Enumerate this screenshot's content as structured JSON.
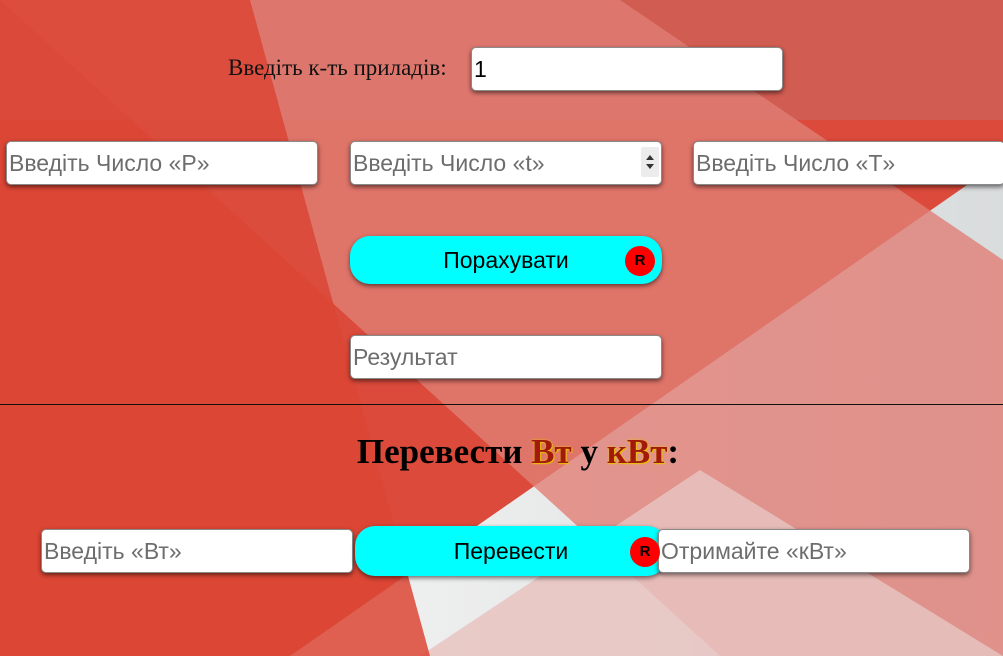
{
  "devices": {
    "label": "Введіть к-ть приладів:",
    "value": "1"
  },
  "inputs": {
    "p_placeholder": "Введіть Число «P»",
    "t_small_placeholder": "Введіть Число «t»",
    "t_big_placeholder": "Введіть Число «T»"
  },
  "calculate": {
    "label": "Порахувати",
    "badge": "R"
  },
  "result": {
    "placeholder": "Результат"
  },
  "convert": {
    "heading_prefix": "Перевести ",
    "heading_unit1": "Вт",
    "heading_middle": " у ",
    "heading_unit2": "кВт",
    "heading_suffix": ":",
    "watts_placeholder": "Введіть «Вт»",
    "button_label": "Перевести",
    "badge": "R",
    "kw_placeholder": "Отримайте «кВт»"
  },
  "colors": {
    "button_bg": "#00ffff",
    "badge_bg": "#ff0000",
    "accent_text": "#a11a0c",
    "background_red": "#db4a3b",
    "background_light": "#e3e3e3"
  }
}
